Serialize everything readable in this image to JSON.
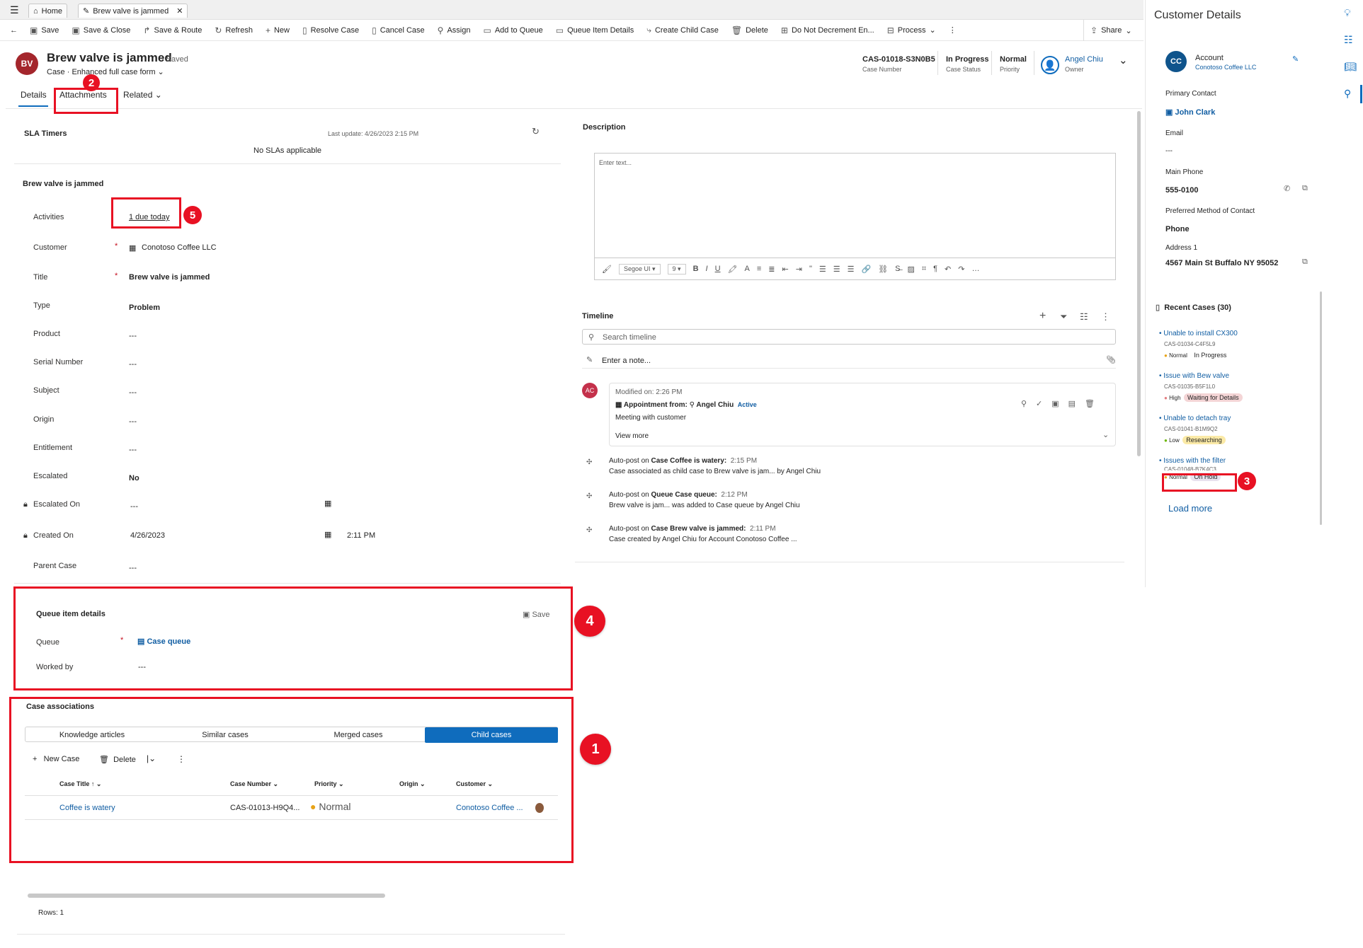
{
  "tabs": {
    "home": "Home",
    "case": "Brew valve is jammed"
  },
  "commands": [
    "Save",
    "Save & Close",
    "Save & Route",
    "Refresh",
    "New",
    "Resolve Case",
    "Cancel Case",
    "Assign",
    "Add to Queue",
    "Queue Item Details",
    "Create Child Case",
    "Delete",
    "Do Not Decrement En...",
    "Process"
  ],
  "share": "Share",
  "header": {
    "avatar": "BV",
    "title": "Brew valve is jammed",
    "saved": "- Saved",
    "entity": "Case",
    "form": "Enhanced full case form",
    "case_number": "CAS-01018-S3N0B5",
    "case_number_label": "Case Number",
    "status": "In Progress",
    "status_label": "Case Status",
    "priority": "Normal",
    "priority_label": "Priority",
    "owner": "Angel Chiu",
    "owner_label": "Owner"
  },
  "formtabs": {
    "details": "Details",
    "attachments": "Attachments",
    "related": "Related"
  },
  "sla": {
    "title": "SLA Timers",
    "last_update": "Last update: 4/26/2023 2:15 PM",
    "empty": "No SLAs applicable"
  },
  "basic": {
    "title": "Brew valve is jammed",
    "activities_label": "Activities",
    "activities": "1 due today",
    "customer_label": "Customer",
    "customer": "Conotoso Coffee LLC",
    "title_label": "Title",
    "type_label": "Type",
    "type": "Problem",
    "product_label": "Product",
    "product": "---",
    "serial_label": "Serial Number",
    "serial": "---",
    "subject_label": "Subject",
    "subject": "---",
    "origin_label": "Origin",
    "origin": "---",
    "entitlement_label": "Entitlement",
    "entitlement": "---",
    "escalated_label": "Escalated",
    "escalated": "No",
    "escalated_on_label": "Escalated On",
    "escalated_on": "---",
    "created_on_label": "Created On",
    "created_on": "4/26/2023",
    "created_time": "2:11 PM",
    "parent_label": "Parent Case",
    "parent": "---"
  },
  "queue": {
    "title": "Queue item details",
    "save": "Save",
    "queue_label": "Queue",
    "queue": "Case queue",
    "worked_label": "Worked by",
    "worked": "---"
  },
  "assoc": {
    "title": "Case associations",
    "segments": [
      "Knowledge articles",
      "Similar cases",
      "Merged cases",
      "Child cases"
    ],
    "new_case": "New Case",
    "delete": "Delete",
    "columns": [
      "Case Title",
      "Case Number",
      "Priority",
      "Origin",
      "Customer"
    ],
    "row": {
      "title": "Coffee is watery",
      "number": "CAS-01013-H9Q4...",
      "priority": "Normal",
      "origin": "",
      "customer": "Conotoso Coffee ..."
    },
    "rows": "Rows: 1"
  },
  "description": {
    "title": "Description",
    "placeholder": "Enter text...",
    "font": "Segoe UI",
    "size": "9"
  },
  "timeline": {
    "title": "Timeline",
    "search": "Search timeline",
    "note": "Enter a note...",
    "card": {
      "avatar": "AC",
      "modified": "Modified on: 2:26 PM",
      "appt": "Appointment from:",
      "who": "Angel Chiu",
      "state": "Active",
      "subject": "Meeting with customer",
      "more": "View more"
    },
    "posts": [
      {
        "head": "Auto-post on",
        "bold": "Case Coffee is watery:",
        "time": "2:15 PM",
        "text": "Case associated as child case to Brew valve is jam... by Angel Chiu"
      },
      {
        "head": "Auto-post on",
        "bold": "Queue Case queue:",
        "time": "2:12 PM",
        "text": "Brew valve is jam... was added to Case queue by Angel Chiu"
      },
      {
        "head": "Auto-post on",
        "bold": "Case Brew valve is jammed:",
        "time": "2:11 PM",
        "text": "Case created by Angel Chiu for Account Conotoso Coffee ..."
      }
    ]
  },
  "side": {
    "title": "Customer Details",
    "avatar": "CC",
    "account_label": "Account",
    "account": "Conotoso Coffee LLC",
    "contact_label": "Primary Contact",
    "contact": "John Clark",
    "email_label": "Email",
    "email": "---",
    "phone_label": "Main Phone",
    "phone": "555-0100",
    "method_label": "Preferred Method of Contact",
    "method": "Phone",
    "address_label": "Address 1",
    "address": "4567 Main St Buffalo NY 95052",
    "recent": "Recent Cases (30)",
    "cases": [
      {
        "title": "Unable to install CX300",
        "num": "CAS-01034-C4F5L9",
        "pri": "Normal",
        "status": "In Progress"
      },
      {
        "title": "Issue with Bew valve",
        "num": "CAS-01035-B5F1L0",
        "pri": "High",
        "status": "Waiting for Details"
      },
      {
        "title": "Unable to detach tray",
        "num": "CAS-01041-B1M9Q2",
        "pri": "Low",
        "status": "Researching"
      },
      {
        "title": "Issues with the filter",
        "num": "CAS-01048-B7K4C3",
        "pri": "Normal",
        "status": "On Hold"
      }
    ],
    "load_more": "Load more"
  },
  "callouts": [
    "1",
    "2",
    "3",
    "4",
    "5"
  ],
  "colors": {
    "accent": "#0f6cbd",
    "red": "#e81123",
    "avatar_bv": "#a4262c",
    "avatar_cc": "#0f548c",
    "avatar_ac": "#c4314b"
  }
}
